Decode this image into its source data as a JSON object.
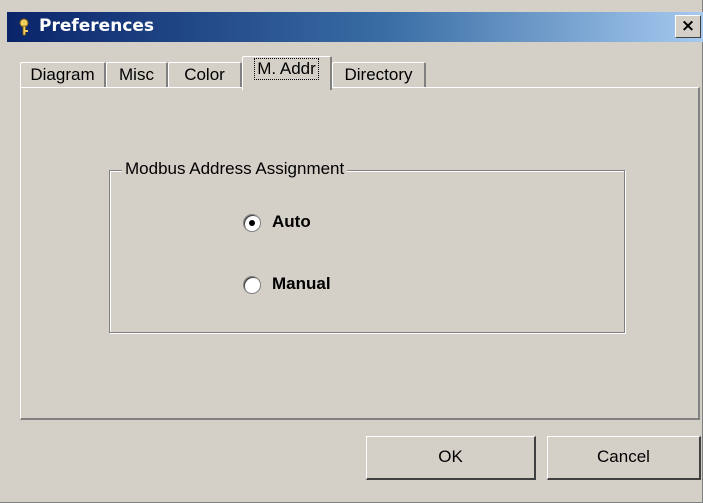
{
  "window": {
    "title": "Preferences",
    "close_label": "×"
  },
  "tabs": [
    {
      "label": "Diagram"
    },
    {
      "label": "Misc"
    },
    {
      "label": "Color"
    },
    {
      "label": "M. Addr",
      "selected": true
    },
    {
      "label": "Directory"
    }
  ],
  "group": {
    "label": "Modbus Address Assignment",
    "options": [
      {
        "label": "Auto",
        "selected": true
      },
      {
        "label": "Manual",
        "selected": false
      }
    ]
  },
  "buttons": {
    "ok_label": "OK",
    "cancel_label": "Cancel"
  },
  "colors": {
    "face": "#d4d0c8",
    "title_start": "#0a246a",
    "title_end": "#a6caf0"
  },
  "icons": {
    "title": "key-icon",
    "close": "close-icon"
  }
}
